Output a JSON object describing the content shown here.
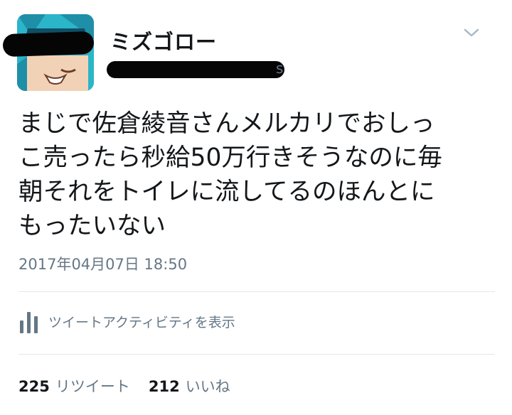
{
  "tweet": {
    "display_name": "ミズゴロー",
    "handle_prefix": "@",
    "handle_suffix": "s",
    "text": "まじで佐倉綾音さんメルカリでおしっ\nこ売ったら秒給50万行きそうなのに毎\n朝それをトイレに流してるのほんとに\nもったいない",
    "timestamp": "2017年04月07日 18:50",
    "activity_label": "ツイートアクティビティを表示",
    "stats": {
      "retweets_count": "225",
      "retweets_label": "リツイート",
      "likes_count": "212",
      "likes_label": "いいね"
    }
  },
  "icons": {
    "menu": "chevron-down-icon",
    "activity": "bar-chart-icon"
  },
  "colors": {
    "text": "#14171a",
    "secondary": "#657786",
    "divider": "#e1e8ed",
    "avatar_bg": "#2bb5c9"
  }
}
